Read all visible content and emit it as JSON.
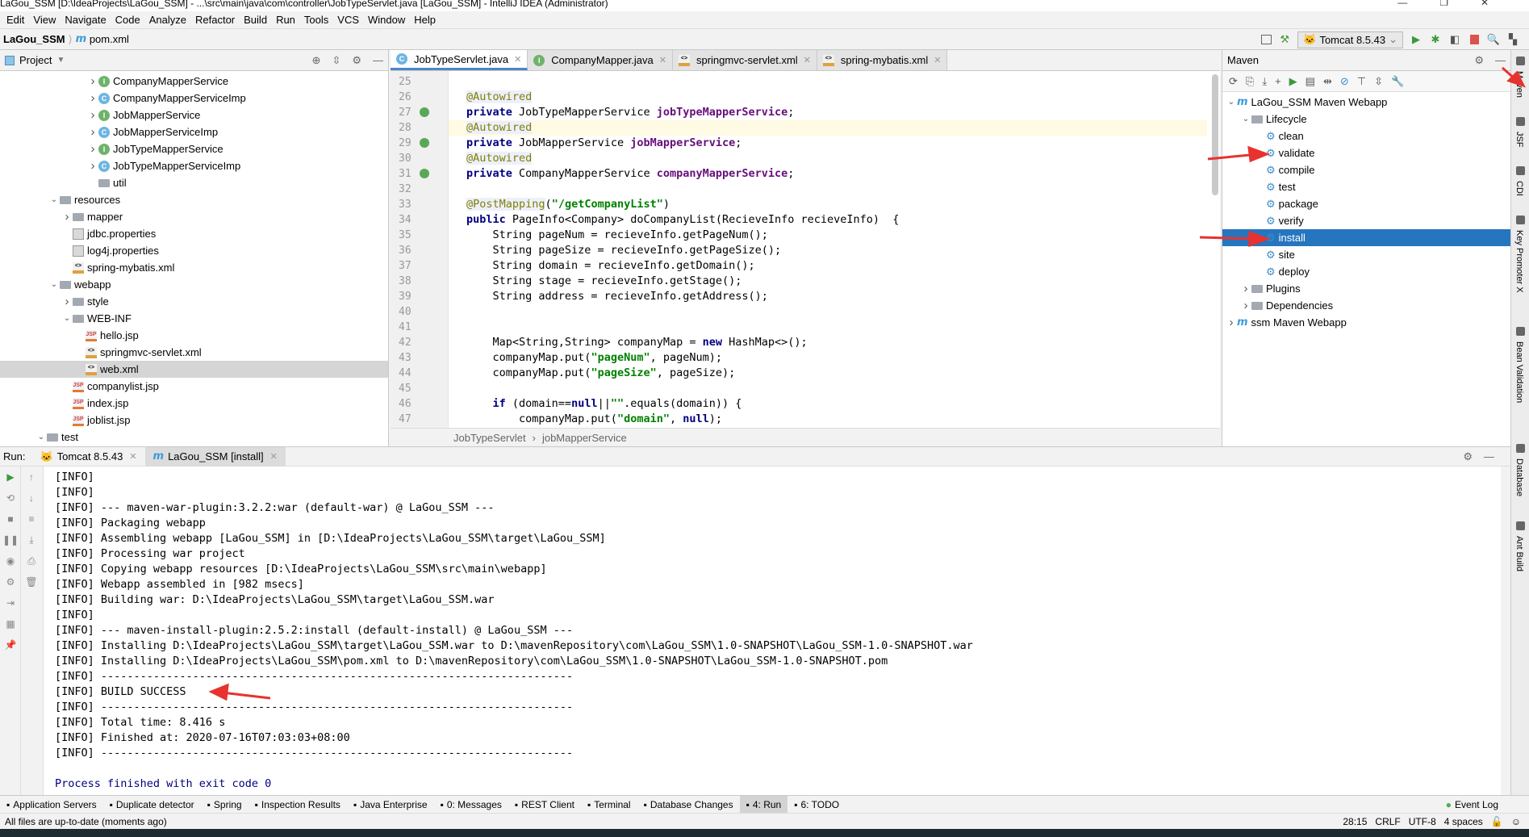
{
  "window": {
    "title": "LaGou_SSM [D:\\IdeaProjects\\LaGou_SSM] - ...\\src\\main\\java\\com\\controller\\JobTypeServlet.java [LaGou_SSM] - IntelliJ IDEA (Administrator)"
  },
  "menu": [
    "Edit",
    "View",
    "Navigate",
    "Code",
    "Analyze",
    "Refactor",
    "Build",
    "Run",
    "Tools",
    "VCS",
    "Window",
    "Help"
  ],
  "nav": {
    "project": "LaGou_SSM",
    "file": "pom.xml",
    "run_config": "Tomcat 8.5.43"
  },
  "project": {
    "title": "Project",
    "items": [
      {
        "label": "CompanyMapperService",
        "indent": 6,
        "arrow": "right",
        "icon": "i"
      },
      {
        "label": "CompanyMapperServiceImp",
        "indent": 6,
        "arrow": "right",
        "icon": "c"
      },
      {
        "label": "JobMapperService",
        "indent": 6,
        "arrow": "right",
        "icon": "i"
      },
      {
        "label": "JobMapperServiceImp",
        "indent": 6,
        "arrow": "right",
        "icon": "c"
      },
      {
        "label": "JobTypeMapperService",
        "indent": 6,
        "arrow": "right",
        "icon": "i"
      },
      {
        "label": "JobTypeMapperServiceImp",
        "indent": 6,
        "arrow": "right",
        "icon": "c"
      },
      {
        "label": "util",
        "indent": 6,
        "arrow": "",
        "icon": "folder"
      },
      {
        "label": "resources",
        "indent": 3,
        "arrow": "down",
        "icon": "folder"
      },
      {
        "label": "mapper",
        "indent": 4,
        "arrow": "right",
        "icon": "folder"
      },
      {
        "label": "jdbc.properties",
        "indent": 4,
        "arrow": "",
        "icon": "file"
      },
      {
        "label": "log4j.properties",
        "indent": 4,
        "arrow": "",
        "icon": "file"
      },
      {
        "label": "spring-mybatis.xml",
        "indent": 4,
        "arrow": "",
        "icon": "xml"
      },
      {
        "label": "webapp",
        "indent": 3,
        "arrow": "down",
        "icon": "folder"
      },
      {
        "label": "style",
        "indent": 4,
        "arrow": "right",
        "icon": "folder"
      },
      {
        "label": "WEB-INF",
        "indent": 4,
        "arrow": "down",
        "icon": "folder"
      },
      {
        "label": "hello.jsp",
        "indent": 5,
        "arrow": "",
        "icon": "jsp"
      },
      {
        "label": "springmvc-servlet.xml",
        "indent": 5,
        "arrow": "",
        "icon": "xml"
      },
      {
        "label": "web.xml",
        "indent": 5,
        "arrow": "",
        "icon": "xml",
        "selected": true
      },
      {
        "label": "companylist.jsp",
        "indent": 4,
        "arrow": "",
        "icon": "jsp"
      },
      {
        "label": "index.jsp",
        "indent": 4,
        "arrow": "",
        "icon": "jsp"
      },
      {
        "label": "joblist.jsp",
        "indent": 4,
        "arrow": "",
        "icon": "jsp"
      },
      {
        "label": "test",
        "indent": 2,
        "arrow": "down",
        "icon": "folder"
      }
    ]
  },
  "editor": {
    "tabs": [
      {
        "label": "JobTypeServlet.java",
        "icon": "c",
        "active": true
      },
      {
        "label": "CompanyMapper.java",
        "icon": "i"
      },
      {
        "label": "springmvc-servlet.xml",
        "icon": "xml"
      },
      {
        "label": "spring-mybatis.xml",
        "icon": "xml"
      }
    ],
    "current_line": 28,
    "lines": [
      {
        "n": 25,
        "t": []
      },
      {
        "n": 26,
        "t": [
          [
            "a",
            "@Autowired"
          ]
        ]
      },
      {
        "n": 27,
        "m": true,
        "t": [
          [
            "k",
            "private "
          ],
          [
            "",
            "JobTypeMapperService "
          ],
          [
            "f",
            "jobTypeMapperService"
          ],
          [
            "",
            ";"
          ]
        ]
      },
      {
        "n": 28,
        "t": [
          [
            "a",
            "@Autowired"
          ]
        ]
      },
      {
        "n": 29,
        "m": true,
        "t": [
          [
            "k",
            "private "
          ],
          [
            "",
            "JobMapperService "
          ],
          [
            "f",
            "jobMapperService"
          ],
          [
            "",
            ";"
          ]
        ]
      },
      {
        "n": 30,
        "t": [
          [
            "a",
            "@Autowired"
          ]
        ]
      },
      {
        "n": 31,
        "m": true,
        "t": [
          [
            "k",
            "private "
          ],
          [
            "",
            "CompanyMapperService "
          ],
          [
            "f",
            "companyMapperService"
          ],
          [
            "",
            ";"
          ]
        ]
      },
      {
        "n": 32,
        "t": []
      },
      {
        "n": 33,
        "t": [
          [
            "a",
            "@PostMapping"
          ],
          [
            "",
            "("
          ],
          [
            "s",
            "\"/getCompanyList\""
          ],
          [
            "",
            ")"
          ]
        ]
      },
      {
        "n": 34,
        "t": [
          [
            "k",
            "public "
          ],
          [
            "",
            "PageInfo<Company> doCompanyList(RecieveInfo recieveInfo)  {"
          ]
        ]
      },
      {
        "n": 35,
        "t": [
          [
            "",
            "    String pageNum = recieveInfo.getPageNum();"
          ]
        ]
      },
      {
        "n": 36,
        "t": [
          [
            "",
            "    String pageSize = recieveInfo.getPageSize();"
          ]
        ]
      },
      {
        "n": 37,
        "t": [
          [
            "",
            "    String domain = recieveInfo.getDomain();"
          ]
        ]
      },
      {
        "n": 38,
        "t": [
          [
            "",
            "    String stage = recieveInfo.getStage();"
          ]
        ]
      },
      {
        "n": 39,
        "t": [
          [
            "",
            "    String address = recieveInfo.getAddress();"
          ]
        ]
      },
      {
        "n": 40,
        "t": []
      },
      {
        "n": 41,
        "t": []
      },
      {
        "n": 42,
        "t": [
          [
            "",
            "    Map<String,String> companyMap = "
          ],
          [
            "k",
            "new "
          ],
          [
            "",
            "HashMap<>();"
          ]
        ]
      },
      {
        "n": 43,
        "t": [
          [
            "",
            "    companyMap.put("
          ],
          [
            "s",
            "\"pageNum\""
          ],
          [
            "",
            ", pageNum);"
          ]
        ]
      },
      {
        "n": 44,
        "t": [
          [
            "",
            "    companyMap.put("
          ],
          [
            "s",
            "\"pageSize\""
          ],
          [
            "",
            ", pageSize);"
          ]
        ]
      },
      {
        "n": 45,
        "t": []
      },
      {
        "n": 46,
        "t": [
          [
            "k",
            "    if "
          ],
          [
            "",
            "(domain=="
          ],
          [
            "k",
            "null"
          ],
          [
            "",
            "||"
          ],
          [
            "s",
            "\"\""
          ],
          [
            "",
            ".equals(domain)) {"
          ]
        ]
      },
      {
        "n": 47,
        "t": [
          [
            "",
            "        companyMap.put("
          ],
          [
            "s",
            "\"domain\""
          ],
          [
            "",
            ", "
          ],
          [
            "k",
            "null"
          ],
          [
            "",
            ");"
          ]
        ]
      }
    ],
    "breadcrumb": [
      "JobTypeServlet",
      "jobMapperService"
    ]
  },
  "maven": {
    "title": "Maven",
    "items": [
      {
        "label": "LaGou_SSM Maven Webapp",
        "indent": 0,
        "arrow": "down",
        "icon": "m"
      },
      {
        "label": "Lifecycle",
        "indent": 1,
        "arrow": "down",
        "icon": "folder"
      },
      {
        "label": "clean",
        "indent": 2,
        "icon": "gear"
      },
      {
        "label": "validate",
        "indent": 2,
        "icon": "gear"
      },
      {
        "label": "compile",
        "indent": 2,
        "icon": "gear"
      },
      {
        "label": "test",
        "indent": 2,
        "icon": "gear"
      },
      {
        "label": "package",
        "indent": 2,
        "icon": "gear"
      },
      {
        "label": "verify",
        "indent": 2,
        "icon": "gear"
      },
      {
        "label": "install",
        "indent": 2,
        "icon": "gear",
        "selected": true
      },
      {
        "label": "site",
        "indent": 2,
        "icon": "gear"
      },
      {
        "label": "deploy",
        "indent": 2,
        "icon": "gear"
      },
      {
        "label": "Plugins",
        "indent": 1,
        "arrow": "right",
        "icon": "folder"
      },
      {
        "label": "Dependencies",
        "indent": 1,
        "arrow": "right",
        "icon": "folder"
      },
      {
        "label": "ssm Maven Webapp",
        "indent": 0,
        "arrow": "right",
        "icon": "m"
      }
    ]
  },
  "right_tabs": [
    "Maven",
    "JSF",
    "CDI",
    "Key Promoter X",
    "Bean Validation",
    "Database",
    "Ant Build"
  ],
  "run": {
    "label": "Run:",
    "tabs": [
      {
        "label": "Tomcat 8.5.43"
      },
      {
        "label": "LaGou_SSM [install]",
        "active": true
      }
    ],
    "output": [
      "[INFO]",
      "[INFO]",
      "[INFO] --- maven-war-plugin:3.2.2:war (default-war) @ LaGou_SSM ---",
      "[INFO] Packaging webapp",
      "[INFO] Assembling webapp [LaGou_SSM] in [D:\\IdeaProjects\\LaGou_SSM\\target\\LaGou_SSM]",
      "[INFO] Processing war project",
      "[INFO] Copying webapp resources [D:\\IdeaProjects\\LaGou_SSM\\src\\main\\webapp]",
      "[INFO] Webapp assembled in [982 msecs]",
      "[INFO] Building war: D:\\IdeaProjects\\LaGou_SSM\\target\\LaGou_SSM.war",
      "[INFO]",
      "[INFO] --- maven-install-plugin:2.5.2:install (default-install) @ LaGou_SSM ---",
      "[INFO] Installing D:\\IdeaProjects\\LaGou_SSM\\target\\LaGou_SSM.war to D:\\mavenRepository\\com\\LaGou_SSM\\1.0-SNAPSHOT\\LaGou_SSM-1.0-SNAPSHOT.war",
      "[INFO] Installing D:\\IdeaProjects\\LaGou_SSM\\pom.xml to D:\\mavenRepository\\com\\LaGou_SSM\\1.0-SNAPSHOT\\LaGou_SSM-1.0-SNAPSHOT.pom",
      "[INFO] ------------------------------------------------------------------------",
      "[INFO] BUILD SUCCESS",
      "[INFO] ------------------------------------------------------------------------",
      "[INFO] Total time: 8.416 s",
      "[INFO] Finished at: 2020-07-16T07:03:03+08:00",
      "[INFO] ------------------------------------------------------------------------",
      ""
    ],
    "finished": "Process finished with exit code 0"
  },
  "toolwindows": [
    {
      "label": "Application Servers"
    },
    {
      "label": "Duplicate detector"
    },
    {
      "label": "Spring"
    },
    {
      "label": "Inspection Results"
    },
    {
      "label": "Java Enterprise"
    },
    {
      "label": "0: Messages"
    },
    {
      "label": "REST Client"
    },
    {
      "label": "Terminal"
    },
    {
      "label": "Database Changes"
    },
    {
      "label": "4: Run",
      "active": true
    },
    {
      "label": "6: TODO"
    }
  ],
  "event_log": "Event Log",
  "status": {
    "message": "All files are up-to-date (moments ago)",
    "position": "28:15",
    "line_sep": "CRLF",
    "encoding": "UTF-8",
    "indent": "4 spaces"
  },
  "colors": {
    "accent": "#2675bf",
    "annotation_arrow": "#e8322f"
  }
}
